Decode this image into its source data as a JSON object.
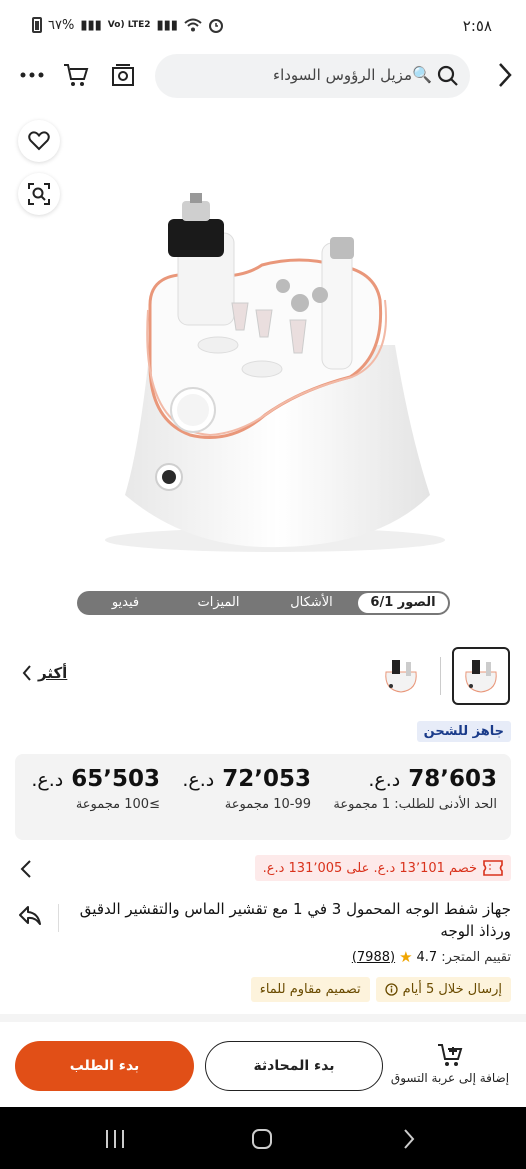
{
  "status_bar": {
    "time": "٢:٥٨",
    "battery": "٦٧%",
    "network": "Vo) LTE2"
  },
  "search": {
    "query": "مزيل الرؤوس السوداء",
    "emoji": "🔍"
  },
  "media_tabs": [
    {
      "label": "الصور",
      "counter": "6/1",
      "active": true
    },
    {
      "label": "الأشكال"
    },
    {
      "label": "الميزات"
    },
    {
      "label": "فيديو"
    }
  ],
  "more_link": "أكثر",
  "ready_badge": "جاهز للشحن",
  "price_tiers": [
    {
      "price": "78٬603",
      "currency": "د.ع.",
      "qty": "الحد الأدنى للطلب: 1 مجموعة"
    },
    {
      "price": "72٬053",
      "currency": "د.ع.",
      "qty": "10-99 مجموعة"
    },
    {
      "price": "65٬503",
      "currency": "د.ع.",
      "qty": "≥100 مجموعة"
    }
  ],
  "discount": "خصم 13٬101 د.ع. على 131٬005 د.ع.",
  "product_title": "جهاز شفط الوجه المحمول 3 في 1 مع تقشير الماس والتقشير الدقيق ورذاذ الوجه",
  "rating": {
    "label": "تقييم المتجر:",
    "value": "4.7",
    "count": "(7988)"
  },
  "tags": [
    {
      "label": "إرسال خلال 5 أيام",
      "icon": "info-icon"
    },
    {
      "label": "تصميم مقاوم للماء"
    }
  ],
  "actions": {
    "add_to_cart": "إضافة إلى عربة التسوق",
    "start_chat": "بدء المحادثة",
    "start_order": "بدء الطلب"
  },
  "colors": {
    "accent": "#e14f17",
    "discount_red": "#d9321c",
    "badge_blue": "#1a3b8a",
    "tag_bg": "#fdf3dc",
    "star": "#f0a500"
  }
}
